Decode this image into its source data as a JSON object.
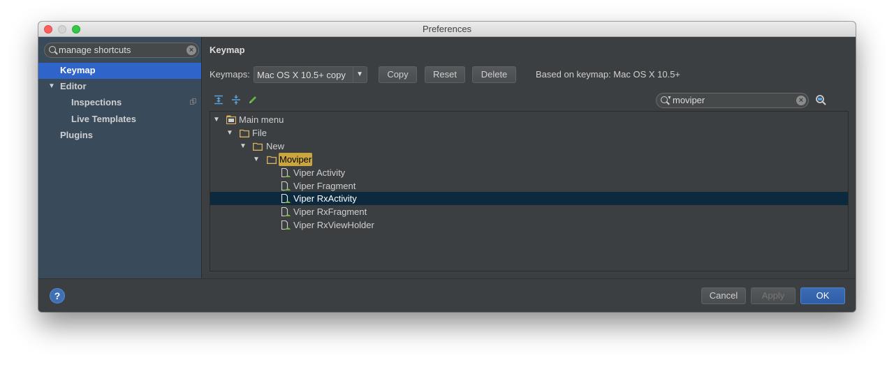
{
  "window": {
    "title": "Preferences"
  },
  "sidebar": {
    "search_value": "manage shortcuts",
    "items": [
      {
        "label": "Keymap"
      },
      {
        "label": "Editor"
      },
      {
        "label": "Inspections"
      },
      {
        "label": "Live Templates"
      },
      {
        "label": "Plugins"
      }
    ]
  },
  "keymap": {
    "heading": "Keymap",
    "keymaps_label": "Keymaps:",
    "selected_keymap": "Mac OS X 10.5+ copy",
    "buttons": {
      "copy": "Copy",
      "reset": "Reset",
      "delete": "Delete"
    },
    "based_on": "Based on keymap: Mac OS X 10.5+",
    "search_value": "moviper",
    "tree": [
      {
        "label": "Main menu"
      },
      {
        "label": "File"
      },
      {
        "label": "New"
      },
      {
        "label": "Moviper"
      },
      {
        "label": "Viper Activity"
      },
      {
        "label": "Viper Fragment"
      },
      {
        "label": "Viper RxActivity"
      },
      {
        "label": "Viper RxFragment"
      },
      {
        "label": "Viper RxViewHolder"
      }
    ]
  },
  "footer": {
    "help_icon": "?",
    "cancel": "Cancel",
    "apply": "Apply",
    "ok": "OK"
  },
  "colors": {
    "accent": "#2f65ca",
    "tree_selection": "#0d293e",
    "search_highlight": "#c9a63e"
  }
}
